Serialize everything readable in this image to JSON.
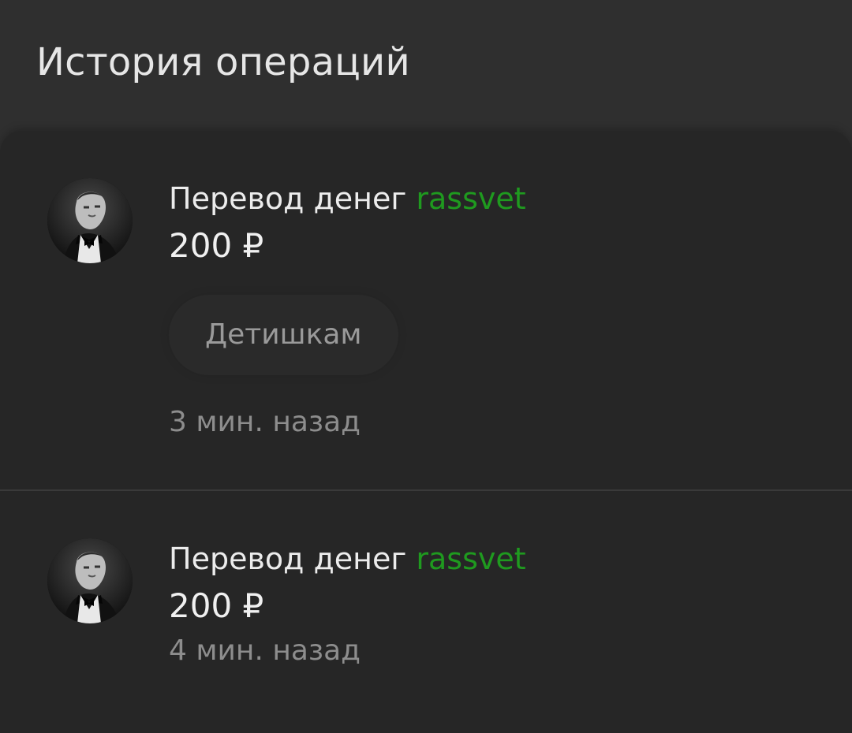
{
  "header": {
    "title": "История операций"
  },
  "operations": [
    {
      "title": "Перевод денег",
      "user": "rassvet",
      "amount": "200 ₽",
      "comment": "Детишкам",
      "time": "3 мин. назад"
    },
    {
      "title": "Перевод денег",
      "user": "rassvet",
      "amount": "200 ₽",
      "time": "4 мин. назад"
    }
  ],
  "colors": {
    "background": "#2f2f2f",
    "card": "#262626",
    "accent_user": "#1f9a1f",
    "muted_text": "#8d8d8d"
  }
}
